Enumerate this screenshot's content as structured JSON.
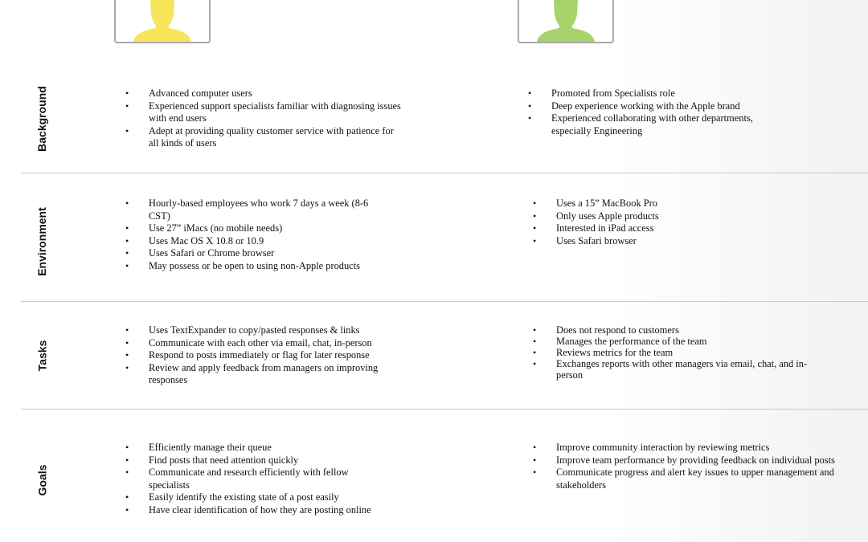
{
  "personas": [
    {
      "avatar_icon": "person-icon",
      "avatar_color": "#f6e55a"
    },
    {
      "avatar_icon": "person-icon",
      "avatar_color": "#a6d36b"
    }
  ],
  "sections": [
    {
      "label": "Background",
      "left": [
        "Advanced computer users",
        "Experienced support specialists familiar with diagnosing issues with end users",
        "Adept at providing quality customer service with patience for all kinds of users"
      ],
      "right": [
        "Promoted from Specialists role",
        "Deep experience working with the Apple brand",
        "Experienced collaborating with other departments, especially Engineering"
      ]
    },
    {
      "label": "Environment",
      "left": [
        "Hourly-based employees who work 7 days a week (8-6 CST)",
        "Use 27” iMacs (no mobile needs)",
        "Uses Mac OS X 10.8 or 10.9",
        "Uses Safari or Chrome browser",
        "May possess or be open to using non-Apple products"
      ],
      "right": [
        "Uses a 15” MacBook Pro",
        "Only uses Apple products",
        "Interested in iPad access",
        "Uses Safari browser"
      ]
    },
    {
      "label": "Tasks",
      "left": [
        "Uses TextExpander to copy/pasted responses & links",
        "Communicate with each other via email, chat, in-person",
        "Respond to posts immediately or flag for later response",
        "Review and apply feedback from managers on improving responses"
      ],
      "right": [
        "Does not respond to customers",
        "Manages the performance of the team",
        "Reviews metrics for the team",
        "Exchanges reports with other managers via email, chat, and in-person"
      ]
    },
    {
      "label": "Goals",
      "left": [
        "Efficiently manage their queue",
        "Find posts that need attention quickly",
        "Communicate and research efficiently with fellow specialists",
        "Easily identify the existing state of a post easily",
        "Have clear identification of how they are posting online"
      ],
      "right": [
        "Improve community interaction by reviewing metrics",
        "Improve team performance by providing feedback on individual posts",
        "Communicate progress and alert key issues to upper management and stakeholders"
      ]
    }
  ]
}
